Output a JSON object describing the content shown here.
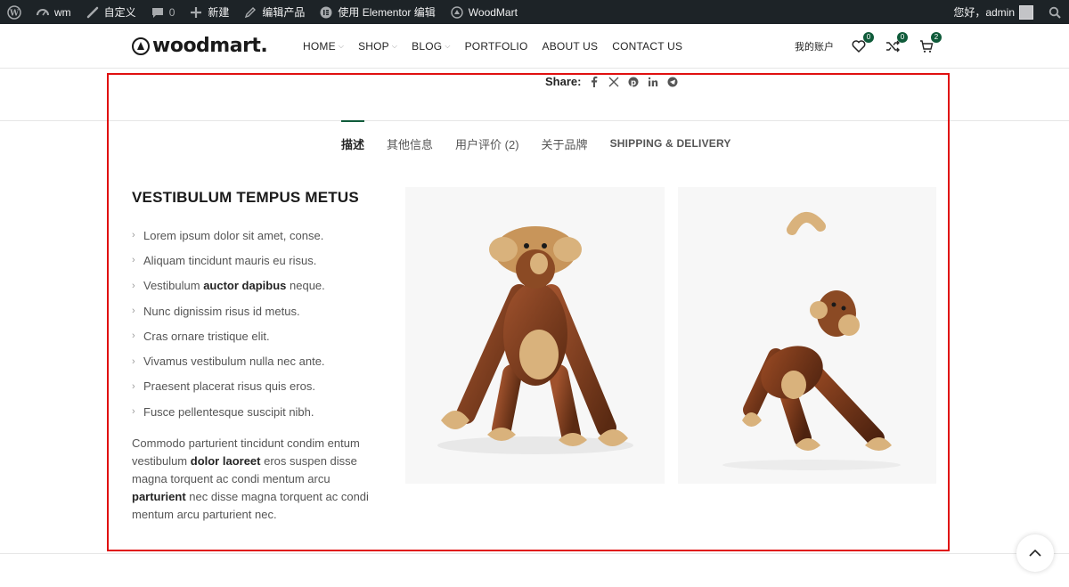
{
  "admin_bar": {
    "site_name": "wm",
    "customize": "自定义",
    "comments_count": "0",
    "new": "新建",
    "edit_product": "编辑产品",
    "elementor_edit": "使用 Elementor 编辑",
    "theme": "WoodMart",
    "greeting": "您好，admin"
  },
  "header": {
    "logo_text": "woodmart.",
    "nav": [
      {
        "label": "HOME",
        "has_dropdown": true
      },
      {
        "label": "SHOP",
        "has_dropdown": true
      },
      {
        "label": "BLOG",
        "has_dropdown": true
      },
      {
        "label": "PORTFOLIO",
        "has_dropdown": false
      },
      {
        "label": "ABOUT US",
        "has_dropdown": false
      },
      {
        "label": "CONTACT US",
        "has_dropdown": false
      }
    ],
    "account_label": "我的账户",
    "wishlist_count": "0",
    "compare_count": "0",
    "cart_count": "2"
  },
  "share": {
    "label": "Share:",
    "icons": [
      "facebook-icon",
      "x-icon",
      "pinterest-icon",
      "linkedin-icon",
      "telegram-icon"
    ]
  },
  "tabs": [
    {
      "label": "描述",
      "active": true
    },
    {
      "label": "其他信息",
      "active": false
    },
    {
      "label": "用户评价 (2)",
      "active": false
    },
    {
      "label": "关于品牌",
      "active": false
    },
    {
      "label": "SHIPPING & DELIVERY",
      "active": false
    }
  ],
  "description": {
    "title": "VESTIBULUM TEMPUS METUS",
    "bullets": [
      {
        "pre": "Lorem ipsum dolor sit amet, conse.",
        "bold": "",
        "post": ""
      },
      {
        "pre": "Aliquam tincidunt mauris eu risus.",
        "bold": "",
        "post": ""
      },
      {
        "pre": "Vestibulum ",
        "bold": "auctor dapibus",
        "post": " neque."
      },
      {
        "pre": "Nunc dignissim risus id metus.",
        "bold": "",
        "post": ""
      },
      {
        "pre": "Cras ornare tristique elit.",
        "bold": "",
        "post": ""
      },
      {
        "pre": "Vivamus vestibulum nulla nec ante.",
        "bold": "",
        "post": ""
      },
      {
        "pre": "Praesent placerat risus quis eros.",
        "bold": "",
        "post": ""
      },
      {
        "pre": "Fusce pellentesque suscipit nibh.",
        "bold": "",
        "post": ""
      }
    ],
    "paragraph": {
      "p1": "Commodo parturient tincidunt condim entum vestibulum ",
      "b1": "dolor laoreet",
      "p2": " eros suspen disse magna torquent ac condi mentum arcu ",
      "b2": "parturient",
      "p3": " nec disse magna torquent ac condi mentum arcu parturient nec."
    }
  },
  "colors": {
    "accent": "#0f5b3a",
    "highlight_border": "#e01010",
    "admin_bar_bg": "#1d2327"
  }
}
